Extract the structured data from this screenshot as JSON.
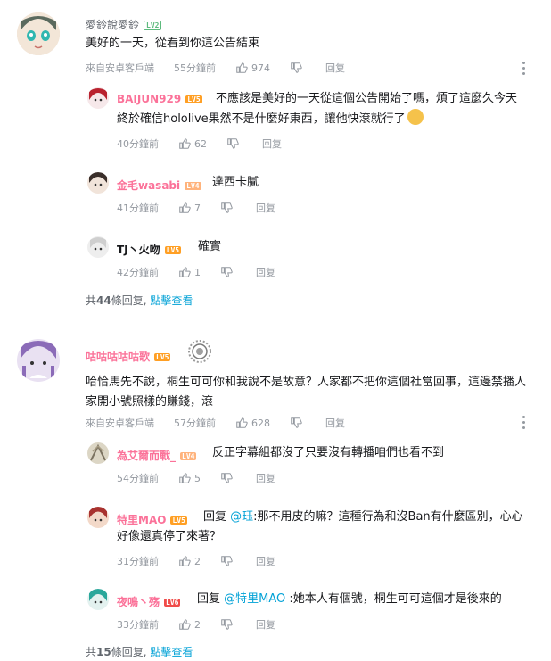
{
  "comments": [
    {
      "username": "愛鈴說愛鈴",
      "level": "LV2",
      "text": "美好的一天，從看到你這公告結束",
      "source": "來自安卓客戶端",
      "time": "55分鐘前",
      "likes": "974",
      "reply_label": "回复",
      "replies": [
        {
          "username": "BAIJUN929",
          "level": "LV5",
          "prefix": "",
          "text": "不應該是美好的一天從這個公告開始了嗎，煩了這麼久今天終於確信hololive果然不是什麼好東西，讓他快滾就行了",
          "time": "40分鐘前",
          "likes": "62",
          "reply_label": "回复"
        },
        {
          "username": "金毛wasabi",
          "level": "LV4",
          "prefix": "",
          "text": "達西卡膩",
          "time": "41分鐘前",
          "likes": "7",
          "reply_label": "回复"
        },
        {
          "username": "TJ丶火吻",
          "level": "LV5",
          "prefix": "",
          "text": "確實",
          "time": "42分鐘前",
          "likes": "1",
          "reply_label": "回复"
        }
      ],
      "more": {
        "prefix": "共",
        "count": "44",
        "suffix": "條回复,",
        "link": "點擊查看"
      }
    },
    {
      "username": "咕咕咕咕咕歌",
      "level": "LV5",
      "text": "哈恰馬先不說，桐生可可你和我說不是故意？人家都不把你這個社當回事，這邊禁播人家開小號照樣的賺錢，滾",
      "source": "來自安卓客戶端",
      "time": "57分鐘前",
      "likes": "628",
      "reply_label": "回复",
      "replies": [
        {
          "username": "為艾爾而戰_",
          "level": "LV4",
          "prefix": "",
          "mention": "",
          "text": "反正字幕組都沒了只要沒有轉播咱們也看不到",
          "time": "54分鐘前",
          "likes": "5",
          "reply_label": "回复"
        },
        {
          "username": "特里MAO",
          "level": "LV5",
          "prefix": "回复 ",
          "mention": "@珏",
          "text": ":那不用皮的嘛？這種行為和沒Ban有什麼區別，心心好像還真停了來著？",
          "time": "31分鐘前",
          "likes": "2",
          "reply_label": "回复"
        },
        {
          "username": "夜鳴丶殇",
          "level": "LV6",
          "prefix": "回复 ",
          "mention": "@特里MAO",
          "text": " :她本人有個號，桐生可可這個才是後來的",
          "time": "33分鐘前",
          "likes": "2",
          "reply_label": "回复"
        }
      ],
      "more": {
        "prefix": "共",
        "count": "15",
        "suffix": "條回复,",
        "link": "點擊查看"
      }
    }
  ],
  "colors": {
    "link": "#00a1d6",
    "meta": "#9499a0",
    "lv_green": "#5dba7d",
    "lv_orange": "#ff9f24",
    "lv_red": "#f04c49",
    "pink_name": "#fb7299"
  },
  "icons": {
    "like": "thumb-up-icon",
    "dislike": "thumb-down-icon",
    "more": "more-vertical-icon",
    "badge": "emblem-icon"
  }
}
